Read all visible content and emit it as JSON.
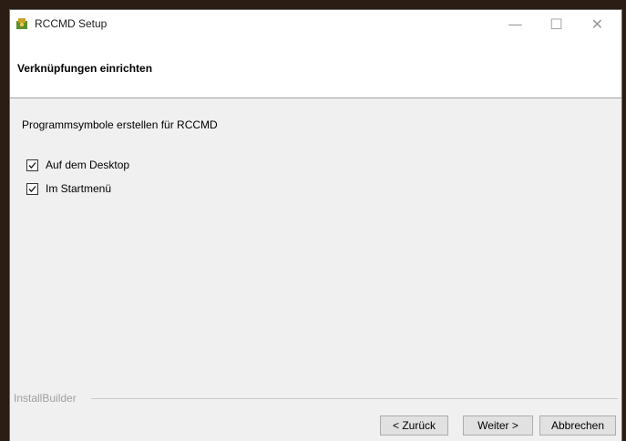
{
  "window": {
    "title": "RCCMD Setup",
    "controls": {
      "minimize": "—",
      "maximize": "☐",
      "close": "✕"
    }
  },
  "header": {
    "title": "Verknüpfungen einrichten"
  },
  "main": {
    "description": "Programmsymbole erstellen für RCCMD",
    "options": [
      {
        "label": "Auf dem Desktop",
        "checked": true
      },
      {
        "label": "Im Startmenü",
        "checked": true
      }
    ]
  },
  "footer": {
    "brand": "InstallBuilder",
    "buttons": {
      "back": "< Zurück",
      "next": "Weiter >",
      "cancel": "Abbrechen"
    }
  }
}
